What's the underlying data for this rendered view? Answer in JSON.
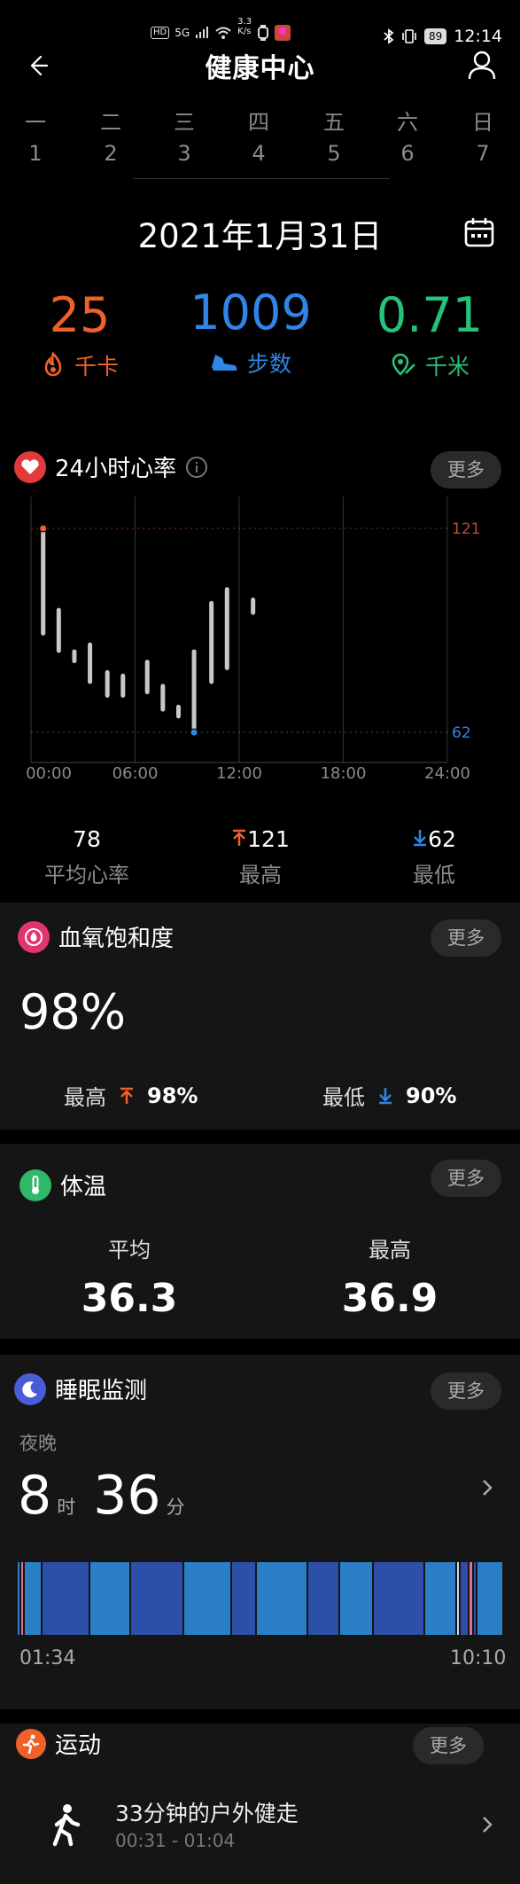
{
  "status_bar": {
    "speed_top": "3.3",
    "speed_bottom": "K/s",
    "network": "5G",
    "battery": "89",
    "time": "12:14"
  },
  "header": {
    "title": "健康中心"
  },
  "week": {
    "days": [
      {
        "weekday": "一",
        "date": "1"
      },
      {
        "weekday": "二",
        "date": "2"
      },
      {
        "weekday": "三",
        "date": "3"
      },
      {
        "weekday": "四",
        "date": "4"
      },
      {
        "weekday": "五",
        "date": "5"
      },
      {
        "weekday": "六",
        "date": "6"
      },
      {
        "weekday": "日",
        "date": "7"
      }
    ]
  },
  "date": "2021年1月31日",
  "summary": {
    "calories": {
      "value": "25",
      "unit": "千卡",
      "color": "#f0612a"
    },
    "steps": {
      "value": "1009",
      "unit": "步数",
      "color": "#2f86e6"
    },
    "distance": {
      "value": "0.71",
      "unit": "千米",
      "color": "#26c27a"
    }
  },
  "heart_rate": {
    "title": "24小时心率",
    "more": "更多",
    "avg_value": "78",
    "avg_label": "平均心率",
    "max_value": "121",
    "max_label": "最高",
    "min_value": "62",
    "min_label": "最低"
  },
  "chart_data": {
    "type": "bar",
    "title": "",
    "x_ticks": [
      "00:00",
      "06:00",
      "12:00",
      "18:00",
      "24:00"
    ],
    "x_range_hours": [
      0,
      24
    ],
    "y_ref_lines": [
      121,
      62
    ],
    "y_range": [
      55,
      125
    ],
    "series": [
      {
        "ranges": [
          {
            "hour": 0.7,
            "low": 90,
            "high": 121
          },
          {
            "hour": 1.6,
            "low": 85,
            "high": 98
          },
          {
            "hour": 2.5,
            "low": 82,
            "high": 86
          },
          {
            "hour": 3.4,
            "low": 76,
            "high": 88
          },
          {
            "hour": 4.4,
            "low": 72,
            "high": 80
          },
          {
            "hour": 5.3,
            "low": 72,
            "high": 79
          },
          {
            "hour": 6.7,
            "low": 73,
            "high": 83
          },
          {
            "hour": 7.6,
            "low": 68,
            "high": 76
          },
          {
            "hour": 8.5,
            "low": 66,
            "high": 70
          },
          {
            "hour": 9.4,
            "low": 62,
            "high": 86
          },
          {
            "hour": 10.4,
            "low": 76,
            "high": 100
          },
          {
            "hour": 11.3,
            "low": 80,
            "high": 104
          },
          {
            "hour": 12.8,
            "low": 96,
            "high": 101
          }
        ]
      }
    ],
    "max_marker": {
      "hour": 0.7,
      "value": 121
    },
    "min_marker": {
      "hour": 9.4,
      "value": 62
    }
  },
  "spo2": {
    "title": "血氧饱和度",
    "more": "更多",
    "value": "98%",
    "max_label": "最高",
    "max_value": "98%",
    "min_label": "最低",
    "min_value": "90%"
  },
  "temperature": {
    "title": "体温",
    "more": "更多",
    "avg_label": "平均",
    "avg_value": "36.3",
    "max_label": "最高",
    "max_value": "36.9"
  },
  "sleep": {
    "title": "睡眠监测",
    "more": "更多",
    "period": "夜晚",
    "hours": "8",
    "hours_unit": "时",
    "minutes": "36",
    "minutes_unit": "分",
    "start": "01:34",
    "end": "10:10"
  },
  "exercise": {
    "title": "运动",
    "more": "更多",
    "activity": "33分钟的户外健走",
    "time_range": "00:31 - 01:04"
  }
}
